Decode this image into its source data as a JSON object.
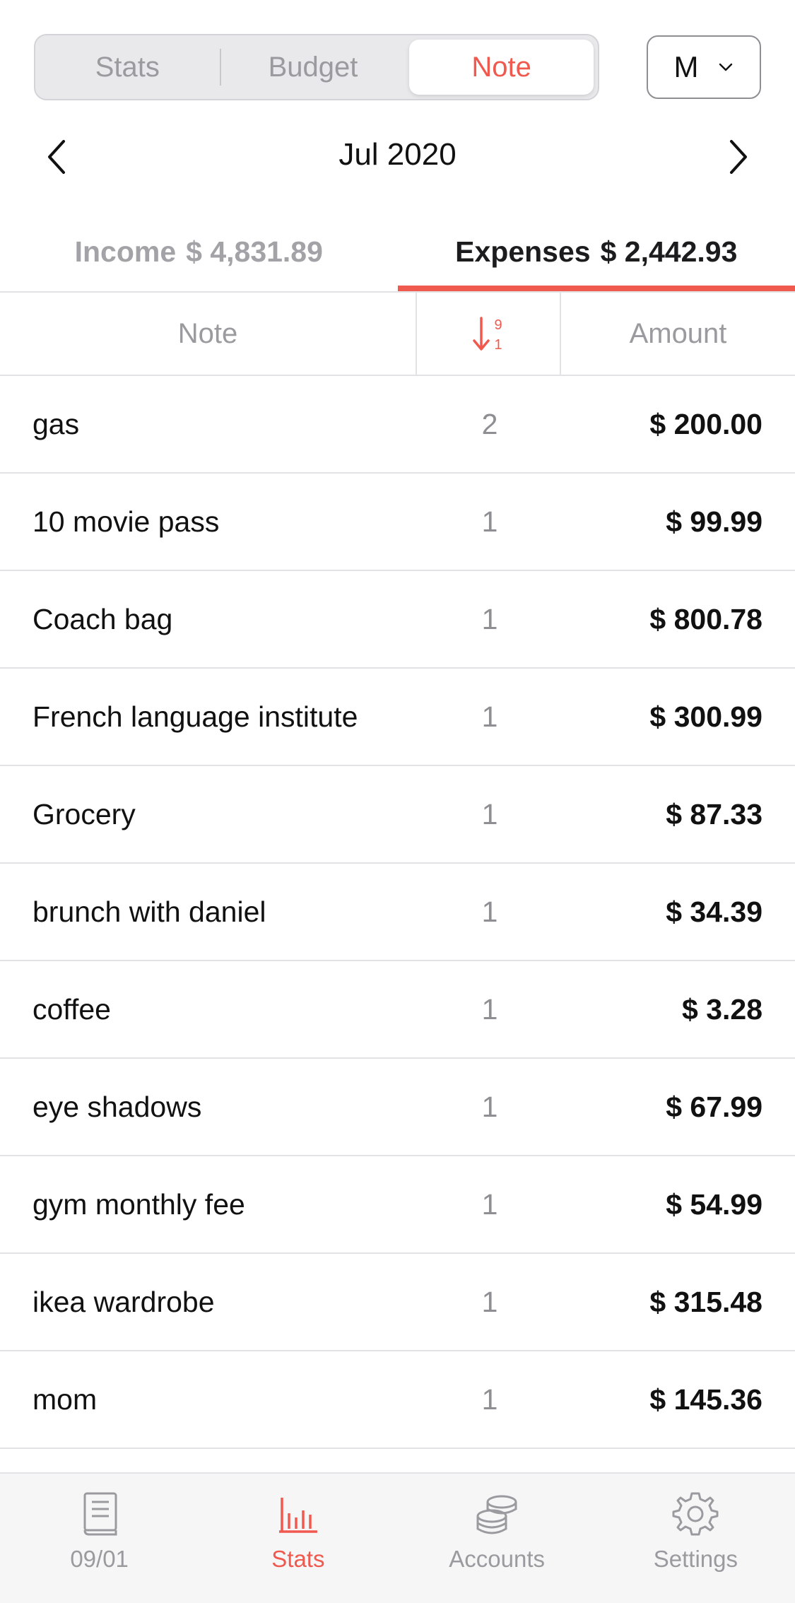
{
  "segmented": {
    "items": [
      {
        "label": "Stats",
        "active": false
      },
      {
        "label": "Budget",
        "active": false
      },
      {
        "label": "Note",
        "active": true
      }
    ]
  },
  "period": {
    "value": "M",
    "icon": "chevron-down-icon"
  },
  "month_nav": {
    "label": "Jul 2020",
    "prev_icon": "chevron-left-icon",
    "next_icon": "chevron-right-icon"
  },
  "totals": {
    "income_label": "Income",
    "income_value": "$ 4,831.89",
    "expenses_label": "Expenses",
    "expenses_value": "$ 2,442.93",
    "active": "expenses"
  },
  "columns": {
    "note": "Note",
    "sort_icon": "sort-9-1-icon",
    "amount": "Amount"
  },
  "rows": [
    {
      "note": "gas",
      "count": "2",
      "amount": "$ 200.00"
    },
    {
      "note": "10 movie pass",
      "count": "1",
      "amount": "$ 99.99"
    },
    {
      "note": "Coach bag",
      "count": "1",
      "amount": "$ 800.78"
    },
    {
      "note": "French language institute",
      "count": "1",
      "amount": "$ 300.99"
    },
    {
      "note": "Grocery",
      "count": "1",
      "amount": "$ 87.33"
    },
    {
      "note": "brunch with daniel",
      "count": "1",
      "amount": "$ 34.39"
    },
    {
      "note": "coffee",
      "count": "1",
      "amount": "$ 3.28"
    },
    {
      "note": "eye shadows",
      "count": "1",
      "amount": "$ 67.99"
    },
    {
      "note": "gym monthly fee",
      "count": "1",
      "amount": "$ 54.99"
    },
    {
      "note": "ikea wardrobe",
      "count": "1",
      "amount": "$ 315.48"
    },
    {
      "note": "mom",
      "count": "1",
      "amount": "$ 145.36"
    }
  ],
  "tabbar": {
    "items": [
      {
        "label": "09/01",
        "icon": "book-icon",
        "active": false
      },
      {
        "label": "Stats",
        "icon": "bar-chart-icon",
        "active": true
      },
      {
        "label": "Accounts",
        "icon": "coins-icon",
        "active": false
      },
      {
        "label": "Settings",
        "icon": "gear-icon",
        "active": false
      }
    ]
  },
  "colors": {
    "accent": "#f0594e",
    "muted": "#9a9a9f",
    "divider": "#e2e2e4"
  }
}
